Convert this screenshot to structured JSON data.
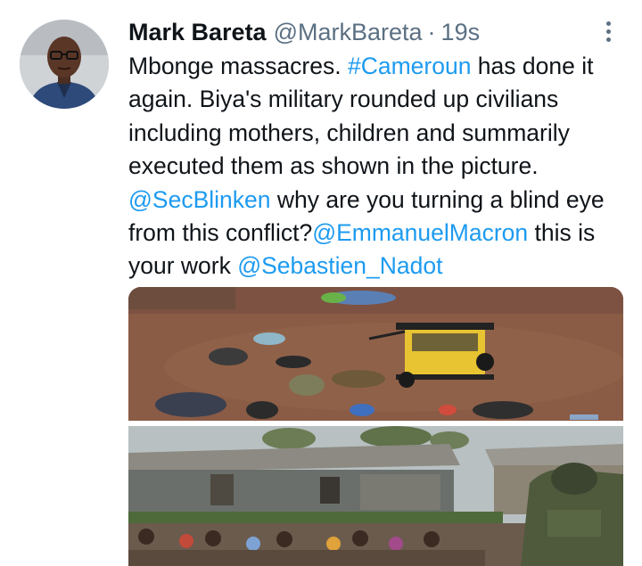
{
  "tweet": {
    "author_name": "Mark Bareta",
    "author_handle": "@MarkBareta",
    "separator": "·",
    "timestamp": "19s",
    "more_icon": "more-vertical-icon",
    "text": {
      "p1": "Mbonge massacres. ",
      "hashtag": "#Cameroun",
      "p2": " has done it again. Biya's military rounded up civilians including mothers, children and summarily executed them as shown in the picture. ",
      "mention1": "@SecBlinken",
      "p3": " why are you turning a blind eye from this conflict?",
      "mention2": "@EmmanuelMacron",
      "p4": " this is your work ",
      "mention3": "@Sebastien_Nadot"
    }
  },
  "media": {
    "count": 2,
    "kind": "photos"
  },
  "colors": {
    "link": "#1d9bf0",
    "text": "#0f1419",
    "secondary": "#5b7083"
  }
}
